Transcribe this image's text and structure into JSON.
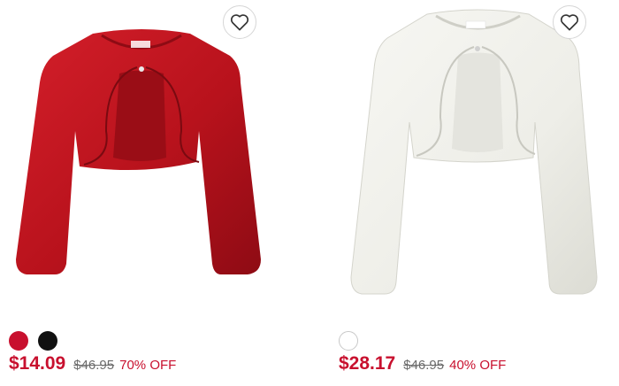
{
  "accent_color": "#c8102e",
  "products": [
    {
      "image_alt": "Red velvet cropped shrug cardigan",
      "garment_color": "#b8121c",
      "wishlist_icon": "heart-outline-icon",
      "swatches": [
        {
          "color": "#c8102e",
          "selected": true
        },
        {
          "color": "#111111",
          "selected": false
        }
      ],
      "price": "$14.09",
      "original_price": "$46.95",
      "discount": "70% OFF"
    },
    {
      "image_alt": "White knit cropped shrug cardigan",
      "garment_color": "#f1f1ec",
      "wishlist_icon": "heart-outline-icon",
      "swatches": [
        {
          "color": "#ffffff",
          "selected": true
        }
      ],
      "price": "$28.17",
      "original_price": "$46.95",
      "discount": "40% OFF"
    }
  ]
}
